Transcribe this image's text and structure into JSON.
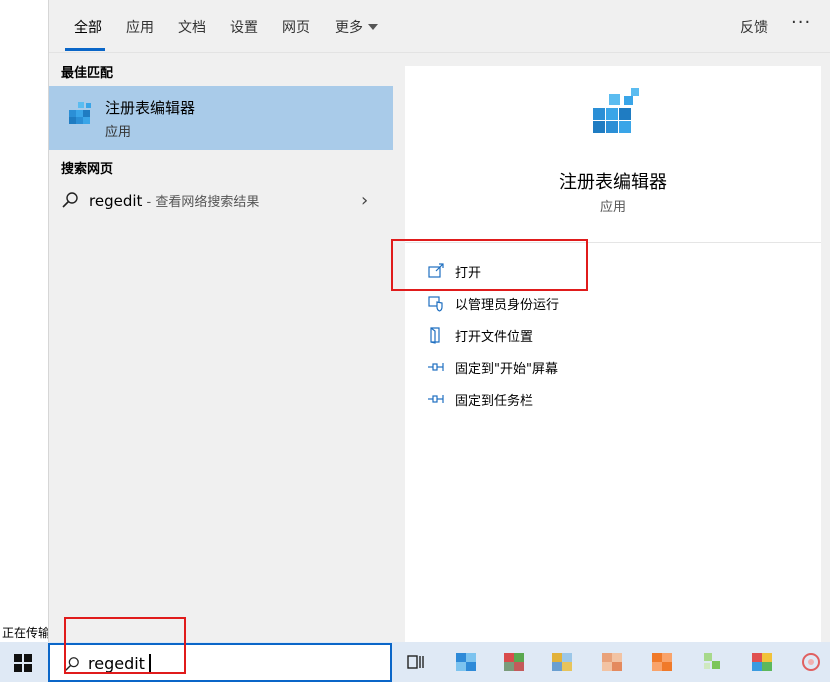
{
  "background": {
    "status_text": "正在传输"
  },
  "tabs": [
    {
      "label": "全部",
      "active": true
    },
    {
      "label": "应用"
    },
    {
      "label": "文档"
    },
    {
      "label": "设置"
    },
    {
      "label": "网页"
    },
    {
      "label": "更多"
    }
  ],
  "topbar": {
    "feedback_label": "反馈",
    "more_label": "···"
  },
  "left": {
    "best_match_title": "最佳匹配",
    "best_match": {
      "name": "注册表编辑器",
      "type": "应用"
    },
    "web_title": "搜索网页",
    "web_result": {
      "query": "regedit",
      "suffix": " - 查看网络搜索结果"
    }
  },
  "detail": {
    "name": "注册表编辑器",
    "type": "应用",
    "actions": [
      {
        "label": "打开",
        "icon": "open-icon"
      },
      {
        "label": "以管理员身份运行",
        "icon": "shield-icon"
      },
      {
        "label": "打开文件位置",
        "icon": "file-location-icon"
      },
      {
        "label": "固定到\"开始\"屏幕",
        "icon": "pin-icon"
      },
      {
        "label": "固定到任务栏",
        "icon": "pin-icon"
      }
    ]
  },
  "taskbar": {
    "search_value": "regedit"
  },
  "colors": {
    "accent": "#0a66c8",
    "selected_bg": "#a9cbe9",
    "annotation_red": "#e01b1b",
    "taskbar_bg": "#dfe9f5"
  }
}
